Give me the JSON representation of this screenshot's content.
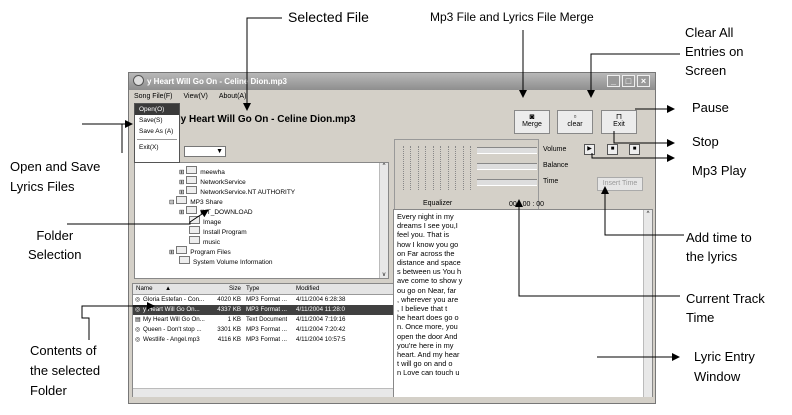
{
  "annotations": {
    "selected_file": "Selected File",
    "merge": "Mp3 File and Lyrics File Merge",
    "clear_all": [
      "Clear All",
      "Entries on",
      "Screen"
    ],
    "pause": "Pause",
    "stop": "Stop",
    "play": "Mp3 Play",
    "open_save": [
      "Open and Save",
      "Lyrics Files"
    ],
    "folder": [
      "Folder",
      "Selection"
    ],
    "add_time": [
      "Add time to",
      "the lyrics"
    ],
    "current_time": [
      "Current Track",
      "Time"
    ],
    "contents": [
      "Contents of",
      "the selected",
      "Folder"
    ],
    "lyric_window": [
      "Lyric Entry",
      "Window"
    ]
  },
  "window": {
    "title": "y Heart Will Go On - Celine Dion.mp3",
    "menu": [
      "Song File(F)",
      "View(V)",
      "About(A)"
    ],
    "file_label": "me :   My Heart Will Go On - Celine Dion.mp3",
    "buttons": {
      "merge": "Merge",
      "clear": "clear",
      "exit": "Exit"
    },
    "dropdown": [
      "Open(O)",
      "Save(S)",
      "Save As (A)",
      "Exit(X)"
    ],
    "tree": [
      "meewha",
      "NetworkService",
      "NetworkService.NT AUTHORITY",
      "MP3 Share",
      "INT_DOWNLOAD",
      "Image",
      "Install Program",
      "music",
      "Program Files",
      "System Volume Information"
    ],
    "file_columns": [
      "Name",
      "Size",
      "Type",
      "Modified"
    ],
    "files": [
      [
        "Gloria Estefan - Con...",
        "4020 KB",
        "MP3 Format ...",
        "4/11/2004 6:28:38"
      ],
      [
        "y Heart Will Go On...",
        "4337 KB",
        "MP3 Format ...",
        "4/11/2004 11:28:0"
      ],
      [
        "My Heart Will Go On...",
        "1 KB",
        "Text Document",
        "4/11/2004 7:19:16"
      ],
      [
        "Queen - Don't stop ...",
        "3301 KB",
        "MP3 Format ...",
        "4/11/2004 7:20:42"
      ],
      [
        "Westlife - Angel.mp3",
        "4116 KB",
        "MP3 Format ...",
        "4/11/2004 10:57:5"
      ]
    ],
    "equalizer_label": "Equalizer",
    "volume_label": "Volume",
    "balance_label": "Balance",
    "time_label": "Time",
    "time_value": "00 : 00 : 00",
    "insert_time": "Insert Time",
    "lyrics": [
      "Every night in my",
      "dreams I see you,I",
      "feel you. That is",
      "how I know you go",
      "on Far across the",
      "distance and space",
      "s between us You h",
      "ave come to show y",
      "ou go on Near, far",
      ", wherever you are",
      ", I believe that t",
      "he heart does go o",
      "n. Once more, you",
      "open the door And",
      "you're here in my",
      "heart. And my hear",
      "t will go on and o",
      "n Love can touch u"
    ]
  }
}
